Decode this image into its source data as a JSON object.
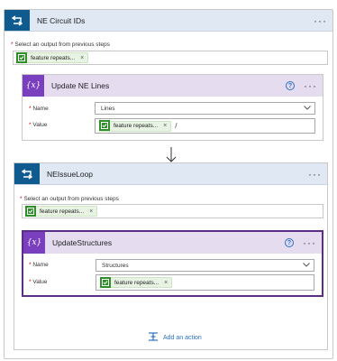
{
  "outer": {
    "title": "NE Circuit IDs",
    "menu": "···",
    "select_label": "Select an output from previous steps",
    "required_mark": "*",
    "token_label": "feature repeats...",
    "token_close": "×"
  },
  "update_ne_lines": {
    "title": "Update NE Lines",
    "icon_text": "{x}",
    "help": "?",
    "menu": "···",
    "name_label": "Name",
    "name_value": "Lines",
    "value_label": "Value",
    "token_label": "feature repeats...",
    "token_close": "×",
    "trailing": "/"
  },
  "inner_loop": {
    "title": "NEIssueLoop",
    "menu": "···",
    "select_label": "Select an output from previous steps",
    "token_label": "feature repeats...",
    "token_close": "×"
  },
  "update_structures": {
    "title": "UpdateStructures",
    "icon_text": "{x}",
    "help": "?",
    "menu": "···",
    "name_label": "Name",
    "name_value": "Structures",
    "value_label": "Value",
    "token_label": "feature repeats...",
    "token_close": "×"
  },
  "add_action": {
    "label": "Add an action"
  },
  "colors": {
    "loop_icon": "#0f5a8f",
    "loop_header": "#dfe8f3",
    "variable_icon": "#7a3fbf",
    "variable_header": "#e5dcf0",
    "token_icon": "#2f8f28",
    "link": "#2b70c4"
  }
}
